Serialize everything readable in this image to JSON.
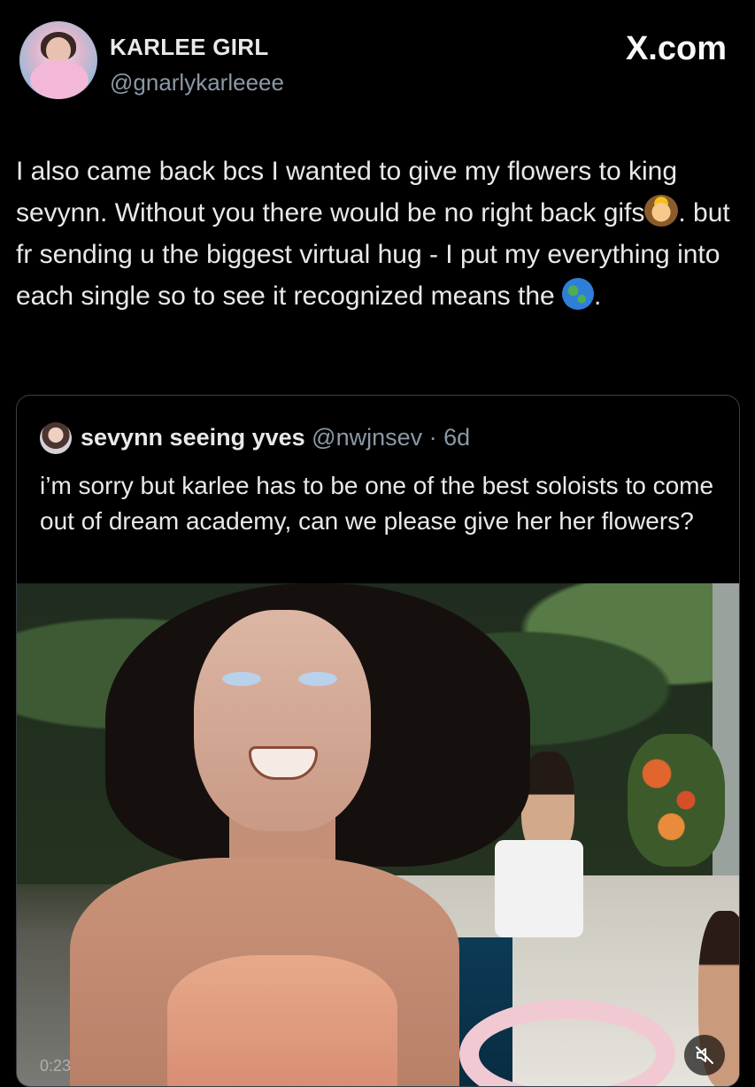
{
  "author": {
    "display_name": "KARLEE GIRL",
    "handle": "@gnarlykarleeee"
  },
  "brand": "X.com",
  "tweet": {
    "part1": "I also came back bcs I wanted to give my flowers to king sevynn. Without you there would be no right back gifs",
    "emoji1": "person-with-crown-emoji",
    "part2": ". but fr sending u the biggest virtual hug - I put my everything into each single so to see it recognized means the ",
    "emoji2": "globe-americas-emoji",
    "part3": "."
  },
  "quoted": {
    "name": "sevynn seeing yves",
    "handle": "@nwjnsev",
    "separator": " · ",
    "time": "6d",
    "text": "i’m sorry but karlee has to be one of the best soloists to come out of dream academy, can we please give her her flowers?",
    "media": {
      "timestamp": "0:23",
      "mute_icon": "volume-muted-icon"
    }
  },
  "colors": {
    "background": "#000000",
    "text": "#e7e9ea",
    "secondary_text": "#8b98a5",
    "border": "#3a3f44"
  }
}
